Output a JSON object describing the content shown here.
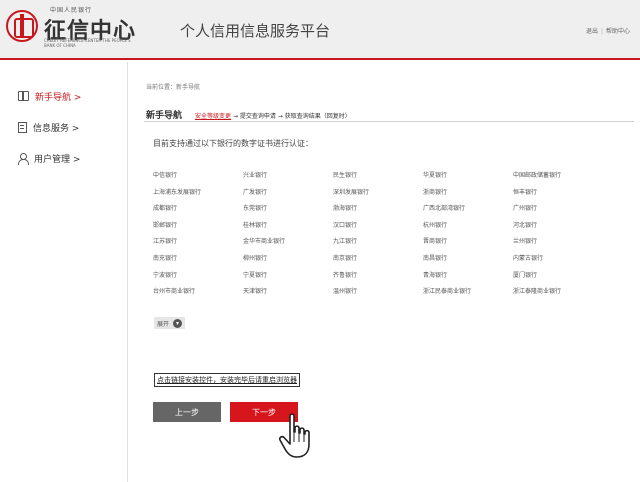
{
  "header": {
    "logo_top": "中国人民银行",
    "logo_cn": "征信中心",
    "logo_en": "CREDIT REFERENCE CENTER THE PEOPLE'S BANK OF CHINA",
    "platform_title": "个人信用信息服务平台",
    "links": [
      "退出",
      "帮助中心"
    ]
  },
  "sidebar": {
    "items": [
      {
        "label": "新手导航 >",
        "icon": "book-icon",
        "active": true
      },
      {
        "label": "信息服务 >",
        "icon": "document-icon",
        "active": false
      },
      {
        "label": "用户管理 >",
        "icon": "user-icon",
        "active": false
      }
    ]
  },
  "main": {
    "breadcrumb": "当前位置：新手导航",
    "title": "新手导航",
    "steps": {
      "step1": "安全等级变更",
      "step2": "→ 提交查询申请 → 获取查询结果（回复时）"
    },
    "intro": "目前支持通过以下银行的数字证书进行认证：",
    "banks": [
      "中信银行",
      "兴业银行",
      "民生银行",
      "华夏银行",
      "中国邮政储蓄银行",
      "上海浦东发展银行",
      "广发银行",
      "深圳发展银行",
      "浙商银行",
      "恒丰银行",
      "成都银行",
      "东莞银行",
      "渤海银行",
      "广西北部湾银行",
      "广州银行",
      "邯郸银行",
      "桂林银行",
      "汉口银行",
      "杭州银行",
      "河北银行",
      "江苏银行",
      "金华市商业银行",
      "九江银行",
      "晋商银行",
      "兰州银行",
      "南充银行",
      "柳州银行",
      "南京银行",
      "南昌银行",
      "内蒙古银行",
      "宁波银行",
      "宁夏银行",
      "齐鲁银行",
      "青海银行",
      "厦门银行",
      "台州市商业银行",
      "天津银行",
      "温州银行",
      "浙江民泰商业银行",
      "浙江泰隆商业银行"
    ],
    "expand_label": "展开",
    "install_link": "点击链接安装控件，安装完毕后请重启浏览器",
    "prev_label": "上一步",
    "next_label": "下一步"
  },
  "colors": {
    "accent": "#c9171e",
    "prev_button": "#666666",
    "next_button": "#d6151c"
  }
}
